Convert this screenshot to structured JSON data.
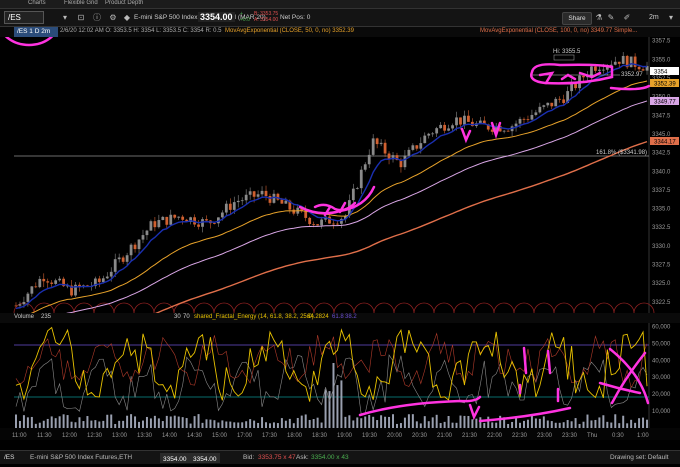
{
  "tabs": [
    "Charts",
    "Flexible Grid",
    "Product Depth"
  ],
  "toolbar": {
    "symbol": "/ES",
    "description": "E-mini S&P 500 Index Futures,ETH (MAR 20)",
    "last": "3354.00",
    "change_line1": "+",
    "change_line2": "+0.0",
    "bid_line1": "B: 3353.75",
    "bid_line2": "A: 3354.00",
    "net_pos": "Net Pos: 0",
    "share_label": "Share",
    "aggregation": "2m"
  },
  "info": {
    "period": "/ES 1 D 2m",
    "ohlc": "2/6/20 12:02 AM   O: 3353.5   H: 3354   L: 3353.5   C: 3354   R: 0.5",
    "ma50": "MovAvgExponential (CLOSE, 50, 0, no)  3352.39",
    "ma100": "MovAvgExponential (CLOSE, 100, 0, no)  3349.77  Simple..."
  },
  "annotations": {
    "hi": "Hi: 3355.5",
    "level_price": "3352.97",
    "fib": "161.8%  ($3341.98)"
  },
  "price_badges": {
    "last": "3354",
    "ma50": "3352.39",
    "ma100": "3349.77",
    "level": "3344.17"
  },
  "lower": {
    "vol_label": "Volume",
    "vol_value": "235",
    "fe_params_left": "30",
    "fe_params_right": "70",
    "fe_label": "shared_Fractal_Energy (14, 61.8, 38.2, 25.0)",
    "fe_value1": "64.2824",
    "fe_value2": "61.8",
    "fe_value3": "38.2"
  },
  "status": {
    "symbol": "/ES",
    "desc": "E-mini S&P 500 Index Futures,ETH",
    "last1": "3354.00",
    "last2": "3354.00",
    "bid_label": "Bid:",
    "bid": "3353.75 x 47",
    "ask_label": "Ask:",
    "ask": "3354.00 x 43",
    "drawing": "Drawing set: Default"
  },
  "colors": {
    "background": "#000000",
    "candle_up": "#8a8a8a",
    "candle_down": "#d06030",
    "ema_fast": "#1a2fb0",
    "ema50": "#e7a22a",
    "ema100": "#d9a6e6",
    "ema200": "#e06f4a",
    "annotation": "#ff33e0",
    "fe_line": "#e8c200",
    "fe_reference": "#6a4fd1"
  },
  "chart_data": [
    {
      "type": "candlestick",
      "title": "",
      "xlabel": "",
      "ylabel": "",
      "x": [
        "11:00",
        "11:30",
        "12:00",
        "12:30",
        "13:00",
        "13:30",
        "14:00",
        "14:30",
        "15:00",
        "17:00",
        "17:30",
        "18:00",
        "18:30",
        "19:00",
        "19:30",
        "20:00",
        "20:30",
        "21:00",
        "21:30",
        "22:00",
        "22:30",
        "23:00",
        "23:30",
        "Thu",
        "0:30",
        "1:00"
      ],
      "y_ticks": [
        3357.5,
        3355,
        3352.5,
        3350,
        3347.5,
        3345,
        3342.5,
        3340,
        3337.5,
        3335,
        3332.5,
        3330,
        3327.5,
        3325,
        3322.5
      ],
      "ylim": [
        3321,
        3358
      ],
      "series": [
        {
          "name": "MovAvgExponential (CLOSE, 50, 0, no)",
          "last": 3352.39
        },
        {
          "name": "MovAvgExponential (CLOSE, 100, 0, no)",
          "last": 3349.77
        }
      ],
      "close_approx": [
        3322,
        3326,
        3324,
        3325,
        3329,
        3333,
        3334,
        3333,
        3336,
        3337,
        3335,
        3333,
        3334,
        3344,
        3341,
        3345,
        3347,
        3346,
        3346,
        3348,
        3350,
        3354,
        3355,
        3354
      ],
      "levels": [
        3344.17,
        3341.98
      ]
    },
    {
      "type": "line",
      "title": "",
      "xlabel": "",
      "ylabel": "",
      "y_ticks": [
        60000,
        50000,
        40000,
        30000,
        20000,
        10000
      ],
      "ylim": [
        0,
        62000
      ],
      "reference_lines": [
        61.8,
        38.2
      ],
      "series": [
        {
          "name": "shared_Fractal_Energy (14, 61.8, 38.2, 25.0)",
          "last": 64.2824
        }
      ]
    }
  ]
}
